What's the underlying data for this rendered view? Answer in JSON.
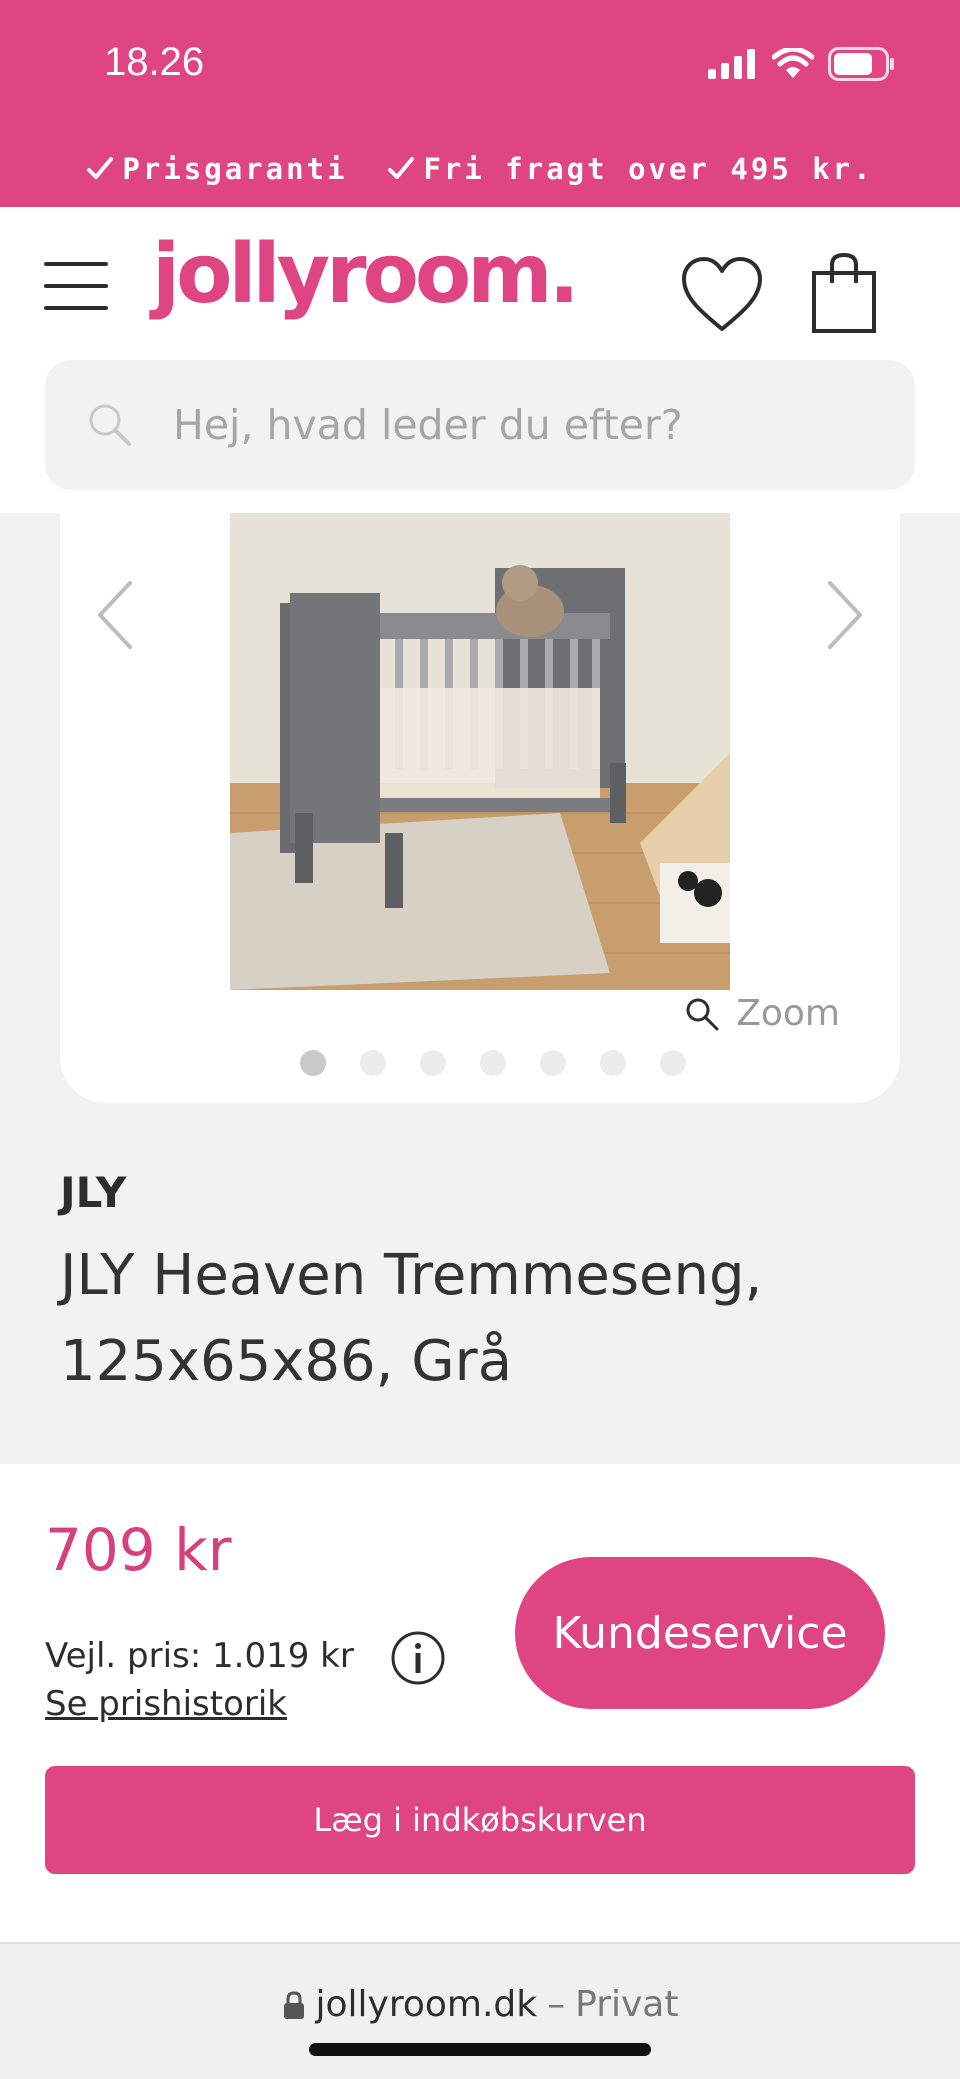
{
  "status": {
    "time": "18.26"
  },
  "promo": {
    "items": [
      "Prisgaranti",
      "Fri fragt over 495 kr."
    ]
  },
  "header": {
    "logo": "jollyroom."
  },
  "search": {
    "placeholder": "Hej, hvad leder du efter?"
  },
  "gallery": {
    "zoom_label": "Zoom",
    "dot_count": 7,
    "active_index": 0
  },
  "product": {
    "brand": "JLY",
    "title": "JLY Heaven Tremmeseng, 125x65x86, Grå"
  },
  "purchase": {
    "price": "709 kr",
    "rrp": "Vejl. pris: 1.019 kr",
    "price_history": "Se prishistorik",
    "support": "Kundeservice",
    "add_to_cart": "Læg i indkøbskurven"
  },
  "browser": {
    "domain": "jollyroom.dk",
    "separator": "–",
    "mode": "Privat"
  },
  "colors": {
    "brand": "#df4483",
    "text": "#2d2d2d",
    "background": "#f2f2f2"
  },
  "icons": [
    "signal-icon",
    "wifi-icon",
    "battery-icon",
    "check-icon",
    "menu-icon",
    "heart-icon",
    "bag-icon",
    "search-icon",
    "chevron-left-icon",
    "chevron-right-icon",
    "zoom-icon",
    "info-icon",
    "lock-icon"
  ]
}
